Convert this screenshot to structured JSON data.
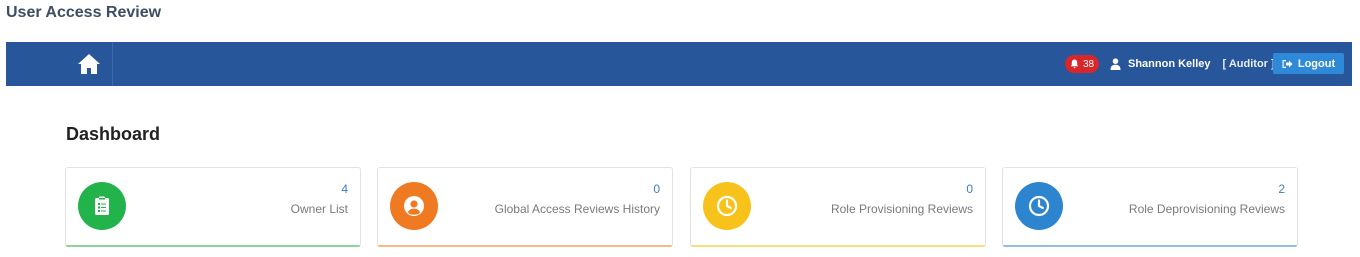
{
  "app": {
    "title": "User Access Review"
  },
  "navbar": {
    "home_icon": "home-icon",
    "notifications": {
      "icon": "bell-icon",
      "count": "38"
    },
    "user": {
      "icon": "user-icon",
      "name": "Shannon Kelley",
      "role": "[ Auditor ]"
    },
    "logout": {
      "icon": "sign-out-icon",
      "label": "Logout"
    }
  },
  "dashboard": {
    "title": "Dashboard",
    "cards": [
      {
        "count": "4",
        "label": "Owner List",
        "icon": "clipboard-icon",
        "color": "#22b34b"
      },
      {
        "count": "0",
        "label": "Global Access Reviews History",
        "icon": "user-circle-icon",
        "color": "#ef7a22"
      },
      {
        "count": "0",
        "label": "Role Provisioning Reviews",
        "icon": "clock-icon",
        "color": "#f7c21a"
      },
      {
        "count": "2",
        "label": "Role Deprovisioning Reviews",
        "icon": "clock-icon",
        "color": "#2d85cf"
      }
    ]
  },
  "colors": {
    "navbar": "#27569a",
    "badge": "#d9262b",
    "logout_button": "#2e8ad8"
  }
}
